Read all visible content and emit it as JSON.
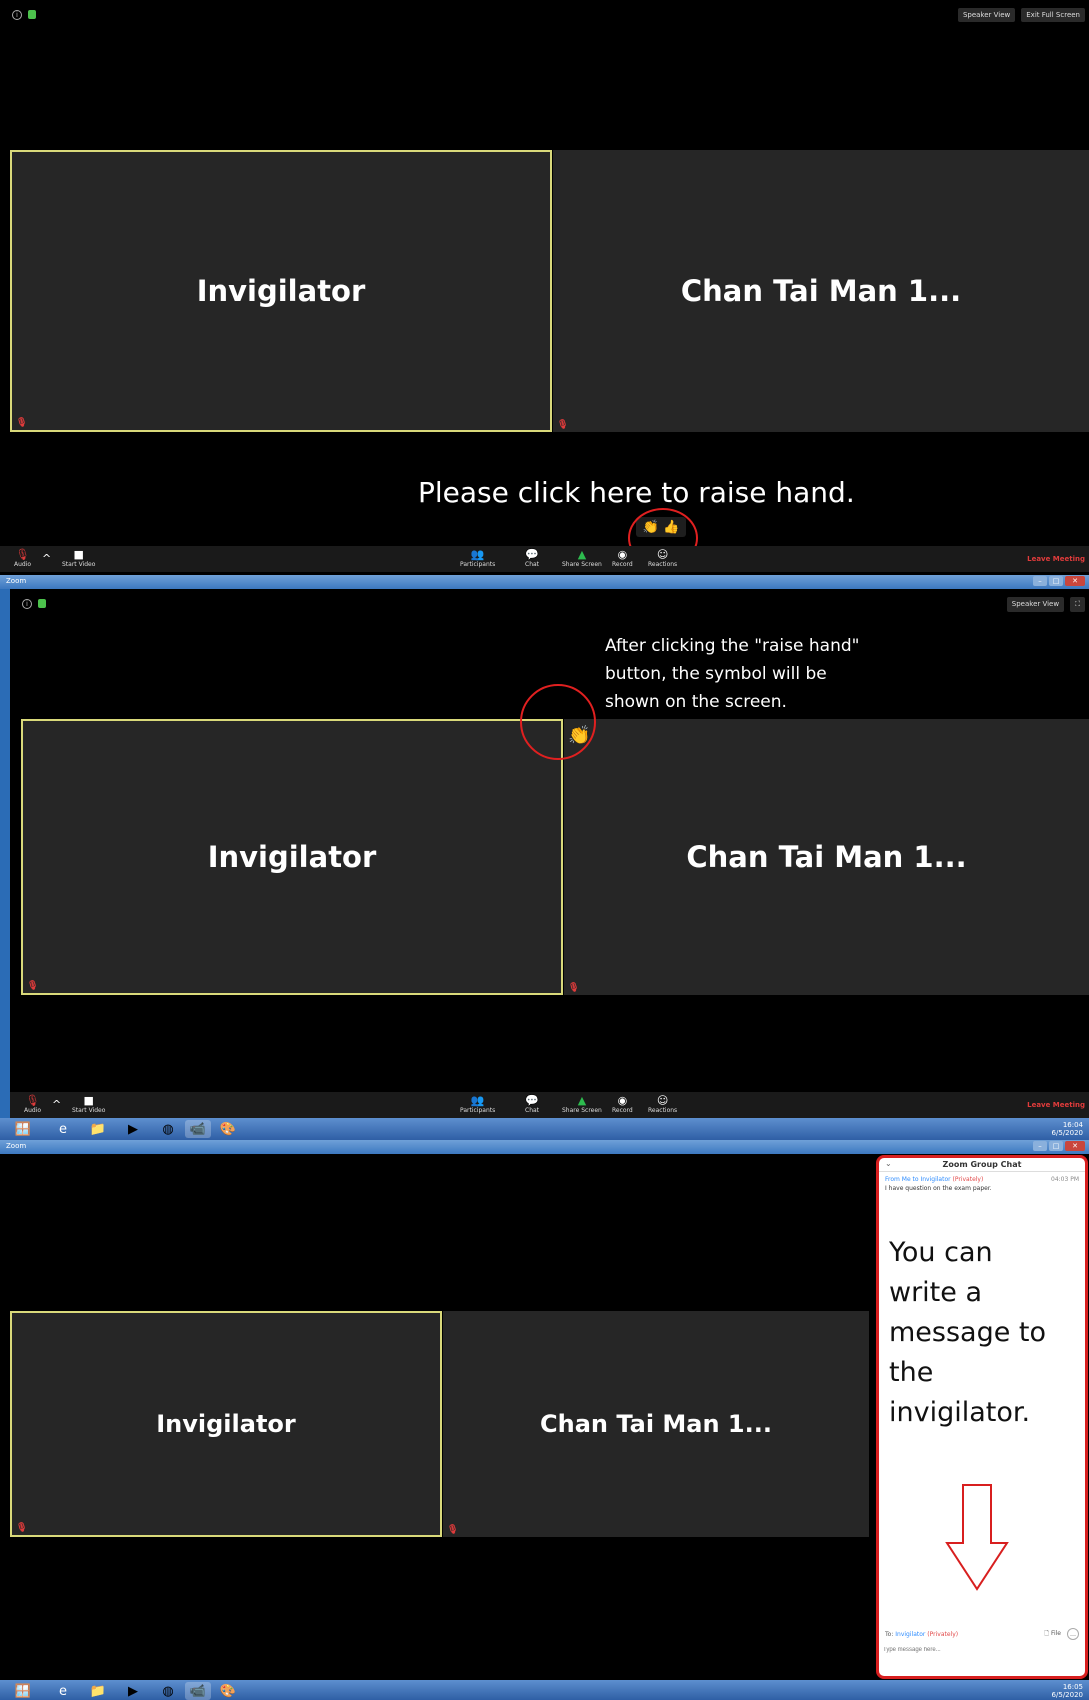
{
  "tiles": {
    "invigilator": "Invigilator",
    "student": "Chan Tai Man 1..."
  },
  "top_buttons": {
    "speaker_view": "Speaker View",
    "exit_full_screen": "Exit Full Screen"
  },
  "toolbar": {
    "audio": "Audio",
    "start_video": "Start Video",
    "participants": "Participants",
    "participants_count": "2",
    "chat": "Chat",
    "share_screen": "Share Screen",
    "record": "Record",
    "reactions": "Reactions",
    "leave": "Leave Meeting"
  },
  "window": {
    "title": "Zoom"
  },
  "annotations": {
    "raise_hand": "Please click here to raise hand.",
    "after_click_1": "After clicking the \"raise hand\"",
    "after_click_2": "button, the symbol will be",
    "after_click_3": "shown on the screen.",
    "message_1": "You can",
    "message_2": "write a",
    "message_3": "message to",
    "message_4": "the",
    "message_5": "invigilator."
  },
  "reactions_popup": {
    "clap": "👏",
    "thumbs": "👍"
  },
  "chat": {
    "title": "Zoom Group Chat",
    "from": "From Me to Invigilator",
    "privately": "(Privately)",
    "time": "04:03 PM",
    "message": "I have question on the exam paper.",
    "to_label": "To:",
    "to_value": "Invigilator",
    "to_private": "(Privately)",
    "file": "File",
    "placeholder": "Type message here..."
  },
  "tray": {
    "time_2": "16:04",
    "date_2": "6/5/2020",
    "time_3": "16:05",
    "date_3": "6/5/2020"
  }
}
